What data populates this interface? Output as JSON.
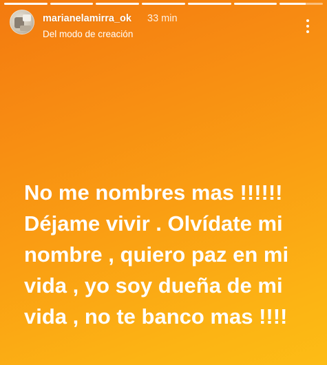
{
  "story": {
    "progress": [
      1,
      1,
      1,
      1,
      1,
      1,
      0.6
    ],
    "header": {
      "username": "marianelamirra_ok",
      "time": "33 min",
      "subtitle": "Del modo de creación",
      "avatar_icon": "profile-photo",
      "menu_icon": "more-vertical-icon"
    },
    "text_lines": [
      "No me nombres mas !!!!!!",
      "Déjame vivir . Olvídate mi",
      "nombre , quiero paz en mi",
      "vida , yo soy dueña de mi",
      "vida , no te banco mas !!!!"
    ],
    "colors": {
      "background_start": "#f37a0f",
      "background_end": "#fdbc15",
      "text": "#ffffff"
    }
  }
}
